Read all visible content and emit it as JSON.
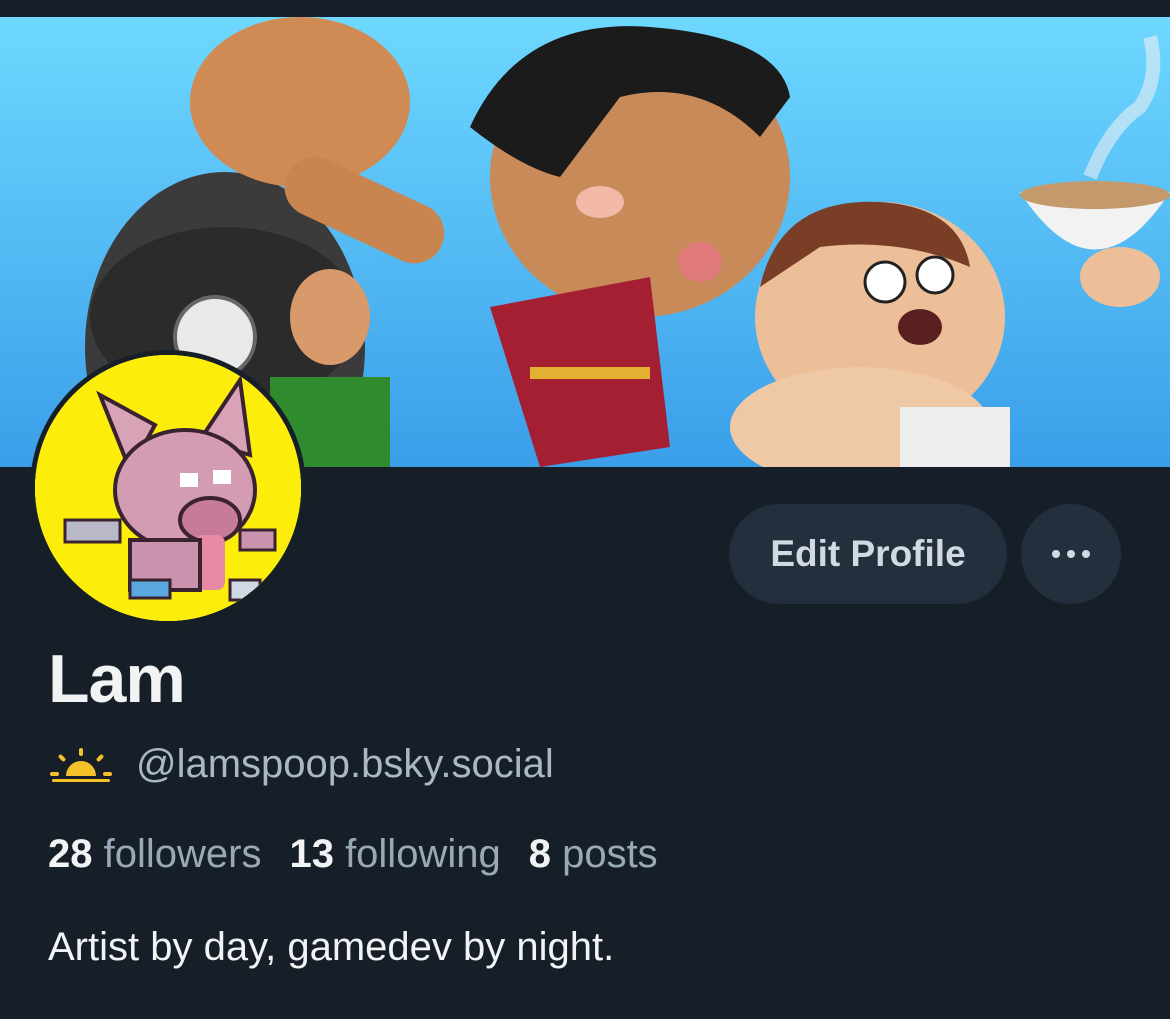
{
  "profile": {
    "display_name": "Lam",
    "handle": "@lamspoop.bsky.social",
    "followers_count": "28",
    "followers_label": "followers",
    "following_count": "13",
    "following_label": "following",
    "posts_count": "8",
    "posts_label": "posts",
    "bio": "Artist by day, gamedev by night."
  },
  "actions": {
    "edit_profile_label": "Edit Profile",
    "more_icon": "ellipsis-icon"
  },
  "icons": {
    "handle_badge": "sunrise-icon"
  },
  "colors": {
    "background": "#161e27",
    "button_bg": "#232f3d",
    "banner_sky": "#46b1f2",
    "avatar_bg": "#fcee0a",
    "sun_icon": "#f5c12b"
  }
}
